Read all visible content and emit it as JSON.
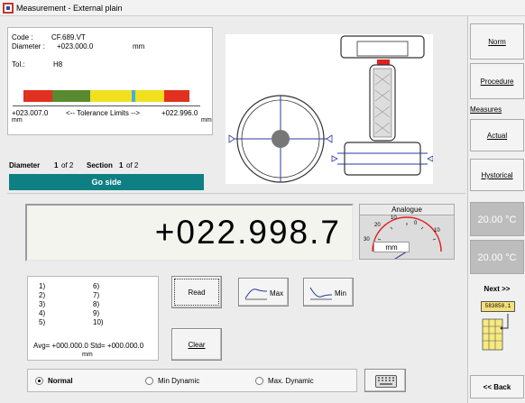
{
  "window": {
    "title": "Measurement - External plain"
  },
  "info": {
    "code_label": "Code :",
    "code_value": "CF.689.VT",
    "diameter_label": "Diameter :",
    "diameter_value": "+023.000.0",
    "diameter_unit": "mm",
    "tol_label": "Tol.:",
    "tol_value": "H8",
    "tol_left_value": "+023.007.0",
    "tol_left_unit": "mm",
    "tol_center_label": "<-- Tolerance Limits -->",
    "tol_right_value": "+022.996.0",
    "tol_right_unit": "mm",
    "tolerance_bar_colors": [
      "#e03020",
      "#5a8a30",
      "#f0e020",
      "#40b0e0",
      "#f0e020",
      "#e03020"
    ]
  },
  "section": {
    "diameter_label": "Diameter",
    "diameter_index": "1",
    "diameter_of": "of 2",
    "section_label": "Section",
    "section_index": "1",
    "section_of": "of 2",
    "side": "Go side"
  },
  "display": {
    "value": "+022.998.7"
  },
  "analogue": {
    "title": "Analogue",
    "ticks": [
      "10",
      "0",
      "10",
      "20",
      "30"
    ],
    "unit": "mm"
  },
  "readings": {
    "slots_left": [
      "1)",
      "2)",
      "3)",
      "4)",
      "5)"
    ],
    "slots_right": [
      "6)",
      "7)",
      "8)",
      "9)",
      "10)"
    ],
    "avg_text": "Avg= +000.000.0  Std= +000.000.0",
    "unit": "mm"
  },
  "buttons": {
    "read": "Read",
    "max": "Max",
    "min": "Min",
    "clear": "Clear"
  },
  "mode": {
    "normal": "Normal",
    "min_dynamic": "Min Dynamic",
    "max_dynamic": "Max. Dynamic",
    "selected": "Normal"
  },
  "right_panel": {
    "norm": "Norm",
    "procedure": "Procedure",
    "measures_label": "Measures",
    "actual": "Actual",
    "historical": "Hystorical",
    "temp1": "20.00 °C",
    "temp2": "20.00 °C",
    "next": "Next >>",
    "back": "<< Back",
    "spreadsheet_readout": "583850.1"
  }
}
